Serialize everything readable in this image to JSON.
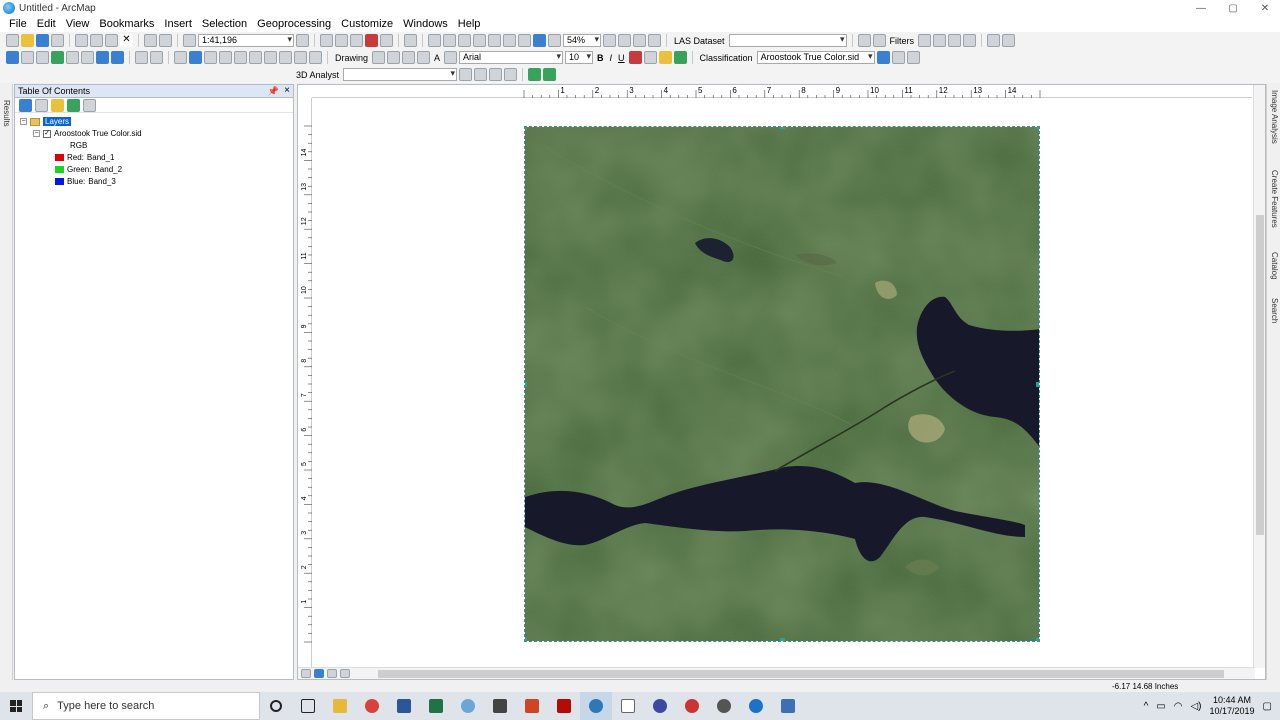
{
  "window": {
    "title": "Untitled - ArcMap"
  },
  "menu": [
    "File",
    "Edit",
    "View",
    "Bookmarks",
    "Insert",
    "Selection",
    "Geoprocessing",
    "Customize",
    "Windows",
    "Help"
  ],
  "standard_toolbar": {
    "scale": "1:41,196"
  },
  "layout_toolbar": {
    "zoom": "54%"
  },
  "las_toolbar": {
    "label": "LAS Dataset",
    "filters": "Filters"
  },
  "drawing_toolbar": {
    "drawing_label": "Drawing",
    "font": "Arial",
    "font_size": "10",
    "bold": "B",
    "italic": "I",
    "underline": "U",
    "text_tool": "A"
  },
  "classification_toolbar": {
    "label": "Classification",
    "layer": "Aroostook True Color.sid"
  },
  "analyst_toolbar": {
    "label": "3D Analyst"
  },
  "toc": {
    "title": "Table Of Contents",
    "pin": "📌",
    "close": "×",
    "root": "Layers",
    "layer": {
      "name": "Aroostook True Color.sid",
      "checked": "✓",
      "renderer": "RGB"
    },
    "bands": [
      {
        "label": "Red:",
        "band": "Band_1",
        "color": "#ff0000"
      },
      {
        "label": "Green:",
        "band": "Band_2",
        "color": "#00ff00"
      },
      {
        "label": "Blue:",
        "band": "Band_3",
        "color": "#0000ff"
      }
    ]
  },
  "left_strip": {
    "results": "Results"
  },
  "right_strip": [
    "Image Analysis",
    "Create Features",
    "Catalog",
    "Search"
  ],
  "ruler_top": [
    "1",
    "2",
    "3",
    "4",
    "5",
    "6",
    "7",
    "8",
    "9",
    "10",
    "11",
    "12",
    "13",
    "14"
  ],
  "ruler_left": [
    "14",
    "13",
    "12",
    "11",
    "10",
    "9",
    "8",
    "7",
    "6",
    "5",
    "4",
    "3",
    "2",
    "1"
  ],
  "status": {
    "coords": "-6.17  14.68 Inches"
  },
  "taskbar": {
    "search_placeholder": "Type here to search",
    "time": "10:44 AM",
    "date": "10/17/2019"
  },
  "colors": {
    "accent": "#0a64d6",
    "water": "#15172a",
    "forest": "#3b5a2e",
    "frame": "#2aa39a"
  }
}
